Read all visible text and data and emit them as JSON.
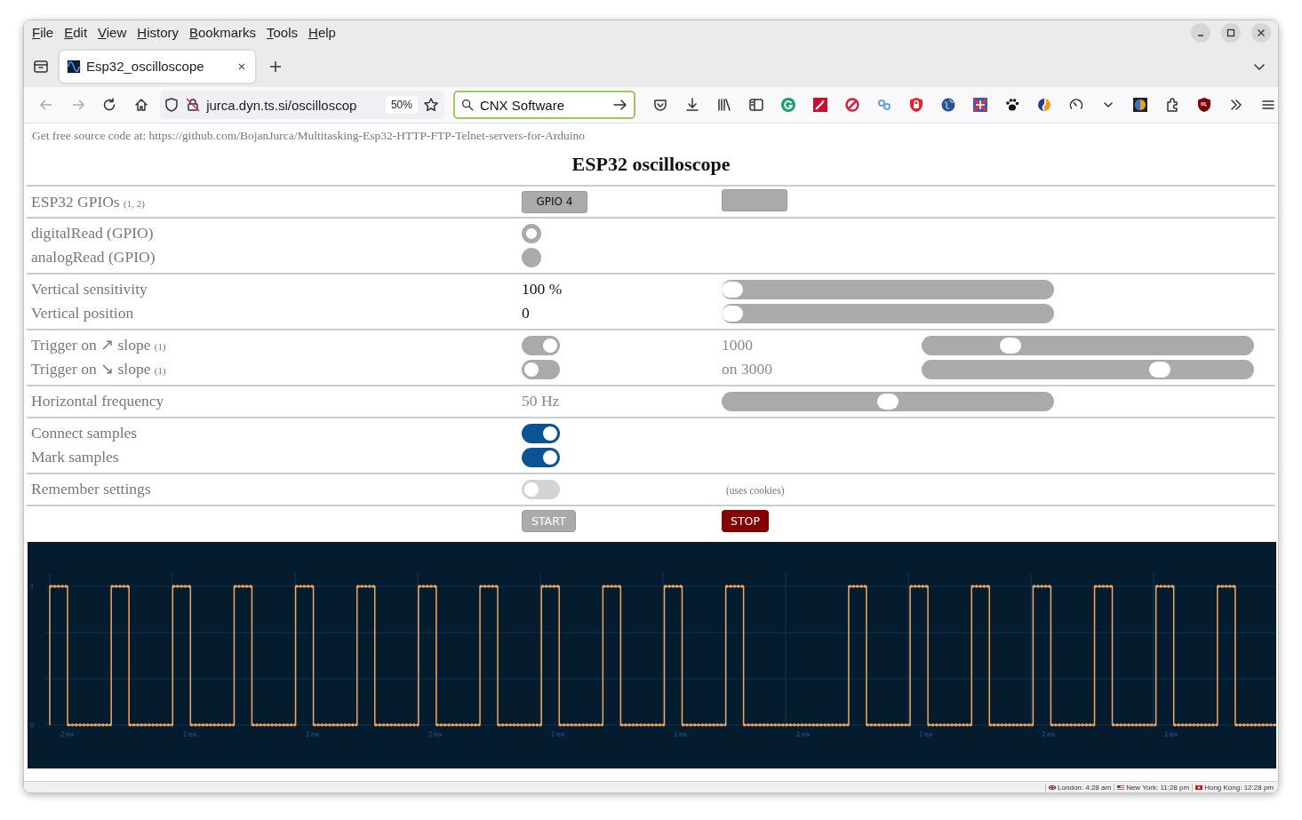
{
  "menu": [
    "File",
    "Edit",
    "View",
    "History",
    "Bookmarks",
    "Tools",
    "Help"
  ],
  "tab": {
    "title": "Esp32_oscilloscope"
  },
  "address_bar": {
    "url": "jurca.dyn.ts.si/oscilloscop",
    "zoom": "50%"
  },
  "search": {
    "value": "CNX Software"
  },
  "page": {
    "source_note": "Get free source code at: https://github.com/BojanJurca/Multitasking-Esp32-HTTP-FTP-Telnet-servers-for-Arduino",
    "title": "ESP32 oscilloscope",
    "settings": [
      {
        "lines": [
          {
            "label": "ESP32 GPIOs",
            "note": "(1, 2)",
            "cells": [
              {
                "kind": "gpio_button",
                "text": "GPIO 4"
              },
              {
                "kind": "gpio_button"
              }
            ]
          }
        ]
      },
      {
        "lines": [
          {
            "label": "digitalRead (GPIO)",
            "cells": [
              {
                "kind": "radio",
                "selected": true
              }
            ]
          },
          {
            "label": "analogRead (GPIO)",
            "cells": [
              {
                "kind": "radio",
                "selected": false
              }
            ]
          }
        ]
      },
      {
        "lines": [
          {
            "label": "Vertical sensitivity",
            "cells": [
              {
                "kind": "value",
                "text": "100 %",
                "disabled": false
              },
              {
                "kind": "slider",
                "level": 0
              }
            ]
          },
          {
            "label": "Vertical position",
            "cells": [
              {
                "kind": "value",
                "text": "0",
                "disabled": false
              },
              {
                "kind": "slider",
                "level": 0
              }
            ]
          }
        ]
      },
      {
        "lines": [
          {
            "label": "Trigger on ↗ slope",
            "note": "(1)",
            "cells": [
              {
                "kind": "toggle",
                "on": true,
                "disabled": true
              },
              {
                "kind": "value",
                "text": "1000",
                "disabled": true
              },
              {
                "kind": "slider",
                "level": 0.25
              }
            ]
          },
          {
            "label": "Trigger on ↘ slope",
            "note": "(1)",
            "cells": [
              {
                "kind": "toggle",
                "on": false,
                "disabled": true
              },
              {
                "kind": "value",
                "text": "on 3000",
                "disabled": true
              },
              {
                "kind": "slider",
                "level": 0.73
              }
            ]
          }
        ]
      },
      {
        "lines": [
          {
            "label": "Horizontal frequency",
            "cells": [
              {
                "kind": "value",
                "text": "50 Hz",
                "disabled": true
              },
              {
                "kind": "slider",
                "level": 0.5
              }
            ]
          }
        ]
      },
      {
        "lines": [
          {
            "label": "Connect samples",
            "cells": [
              {
                "kind": "toggle",
                "on": true,
                "disabled": false
              }
            ]
          },
          {
            "label": "Mark samples",
            "cells": [
              {
                "kind": "toggle",
                "on": true,
                "disabled": false
              }
            ]
          }
        ]
      },
      {
        "lines": [
          {
            "label": "Remember settings",
            "cells": [
              {
                "kind": "toggle",
                "on": false,
                "disabled": false
              },
              {
                "kind": "note",
                "text": "(uses cookies)"
              }
            ]
          }
        ]
      },
      {
        "lines": [
          {
            "cells": [
              {
                "kind": "action_button",
                "text": "START",
                "disabled": true
              },
              {
                "kind": "action_button",
                "text": "STOP",
                "disabled": false
              }
            ]
          }
        ]
      }
    ],
    "scope": {
      "y_labels": [
        "1",
        "0"
      ],
      "x_labels": [
        "2 ms",
        "2 ms",
        "2 ms",
        "2 ms",
        "2 ms",
        "2 ms",
        "2 ms",
        "2 ms",
        "2 ms",
        "2 ms"
      ]
    }
  },
  "status_bar": {
    "clocks": [
      {
        "text": "London: 4:28 am"
      },
      {
        "text": "New York: 11:28 pm"
      },
      {
        "text": "Hong Kong: 12:28 pm"
      }
    ]
  }
}
